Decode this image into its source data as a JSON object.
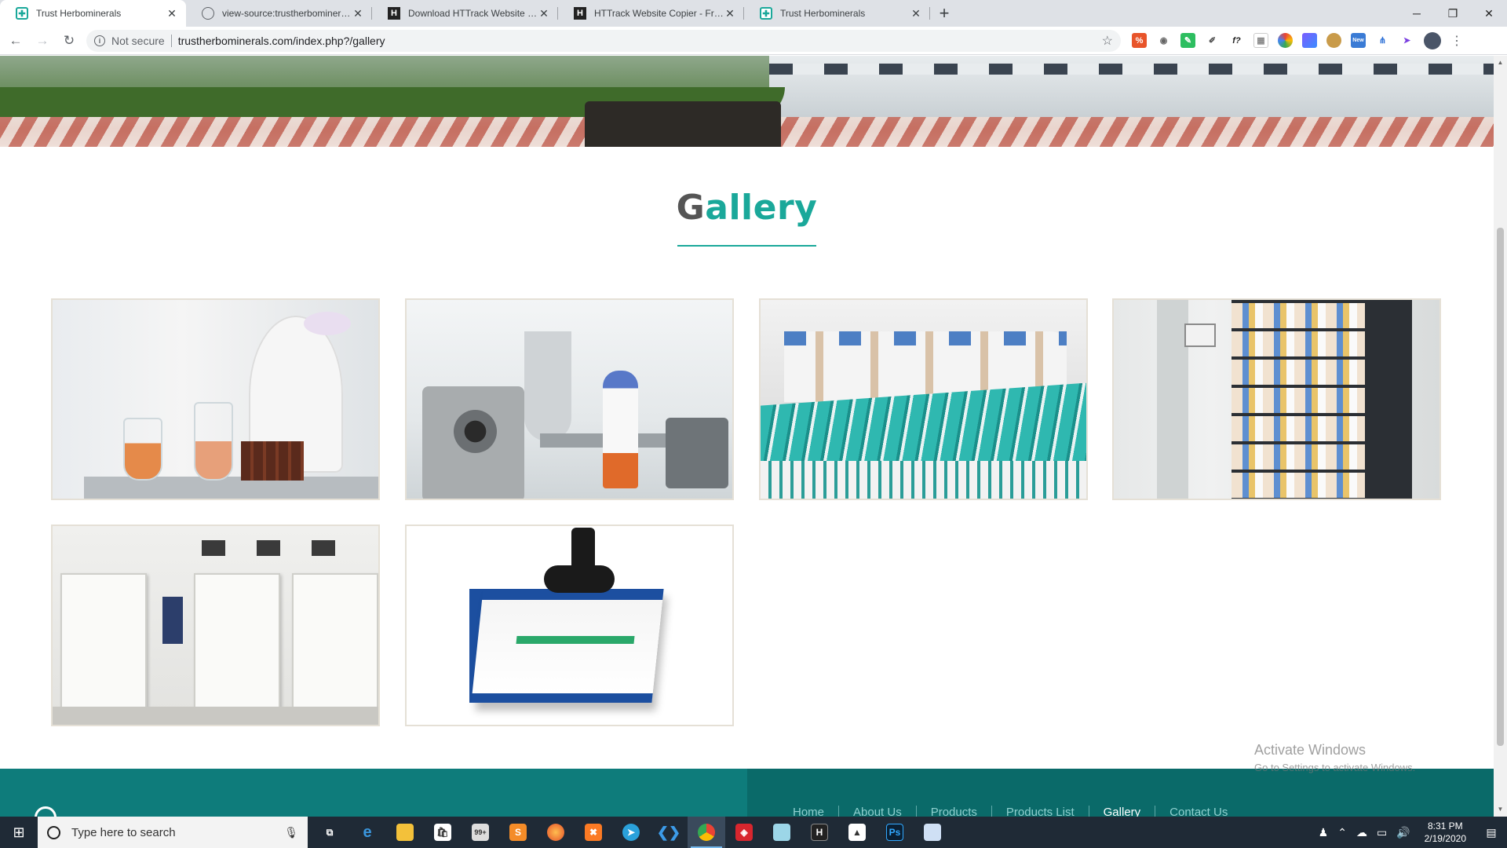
{
  "browser": {
    "tabs": [
      {
        "title": "Trust Herbominerals",
        "icon": "trust-favicon",
        "active": true
      },
      {
        "title": "view-source:trustherbominerals.c",
        "icon": "globe-favicon",
        "active": false
      },
      {
        "title": "Download HTTrack Website Copi",
        "icon": "httrack-favicon",
        "active": false
      },
      {
        "title": "HTTrack Website Copier - Free Sc",
        "icon": "httrack-favicon",
        "active": false
      },
      {
        "title": "Trust Herbominerals",
        "icon": "trust-favicon",
        "active": false
      }
    ],
    "security_label": "Not secure",
    "url": "trustherbominerals.com/index.php?/gallery",
    "accent": "#1aa89a"
  },
  "page": {
    "gallery_title_first": "G",
    "gallery_title_rest": "allery",
    "images": [
      {
        "name": "lab-technician"
      },
      {
        "name": "production-machinery"
      },
      {
        "name": "packaging-workers"
      },
      {
        "name": "storage-racks"
      },
      {
        "name": "cold-rooms"
      },
      {
        "name": "diesel-generator"
      }
    ],
    "footer": {
      "nav": [
        "Home",
        "About Us",
        "Products",
        "Products List",
        "Gallery",
        "Contact Us"
      ],
      "current": "Gallery"
    }
  },
  "watermark": {
    "title": "Activate Windows",
    "subtitle": "Go to Settings to activate Windows."
  },
  "taskbar": {
    "search_placeholder": "Type here to search",
    "time": "8:31 PM",
    "date": "2/19/2020",
    "mail_badge": "99+"
  }
}
